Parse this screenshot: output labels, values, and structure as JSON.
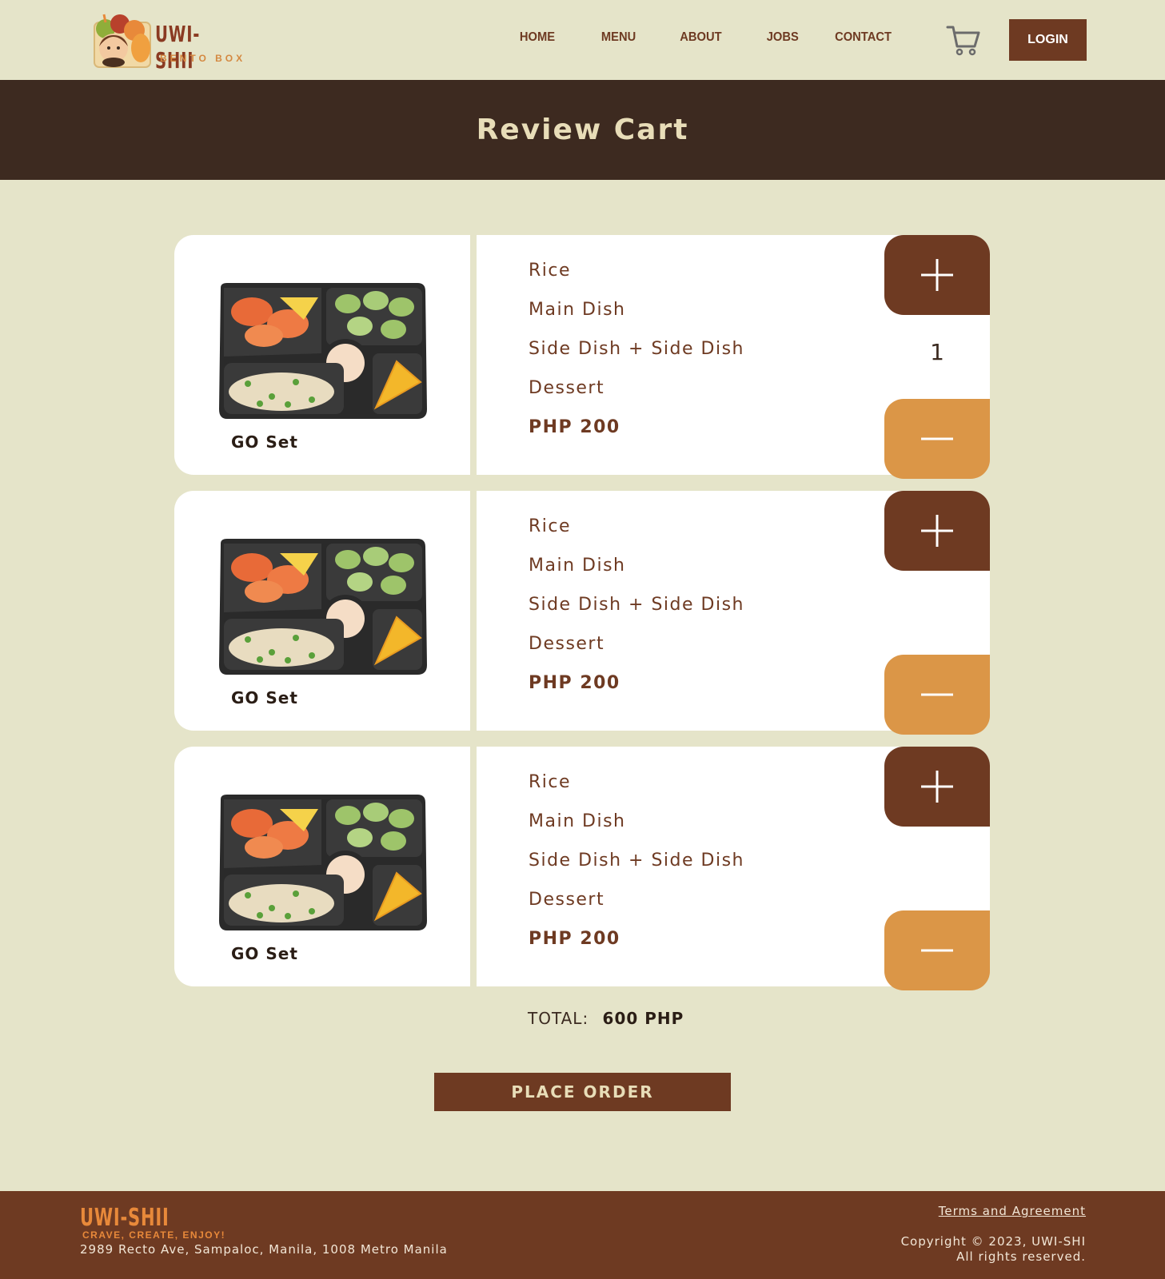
{
  "brand": {
    "name": "UWI-SHII",
    "subtitle": "BENTO BOX"
  },
  "nav": {
    "items": [
      "HOME",
      "MENU",
      "ABOUT",
      "JOBS",
      "CONTACT"
    ],
    "login_label": "LOGIN",
    "cart_icon": "shopping-cart-icon"
  },
  "banner": {
    "title": "Review Cart"
  },
  "cart": {
    "items": [
      {
        "name": "GO Set",
        "lines": [
          "Rice",
          "Main Dish",
          "Side Dish + Side Dish",
          "Dessert"
        ],
        "price": "PHP 200",
        "quantity": "1"
      },
      {
        "name": "GO Set",
        "lines": [
          "Rice",
          "Main Dish",
          "Side Dish + Side Dish",
          "Dessert"
        ],
        "price": "PHP 200",
        "quantity": ""
      },
      {
        "name": "GO Set",
        "lines": [
          "Rice",
          "Main Dish",
          "Side Dish + Side Dish",
          "Dessert"
        ],
        "price": "PHP 200",
        "quantity": ""
      }
    ],
    "total_label": "TOTAL:",
    "total_value": "600 PHP",
    "place_order_label": "PLACE ORDER"
  },
  "footer": {
    "logo": "UWI-SHII",
    "tagline": "CRAVE, CREATE, ENJOY!",
    "address": "2989 Recto Ave, Sampaloc, Manila, 1008 Metro Manila",
    "terms_label": "Terms and Agreement",
    "copyright": "Copyright © 2023, UWI-SHI",
    "rights": "All rights reserved."
  },
  "colors": {
    "page_bg": "#e5e4c9",
    "banner_bg": "#3d2a20",
    "brown": "#6e3a22",
    "orange": "#db9647",
    "banner_text": "#e8ddb8"
  }
}
